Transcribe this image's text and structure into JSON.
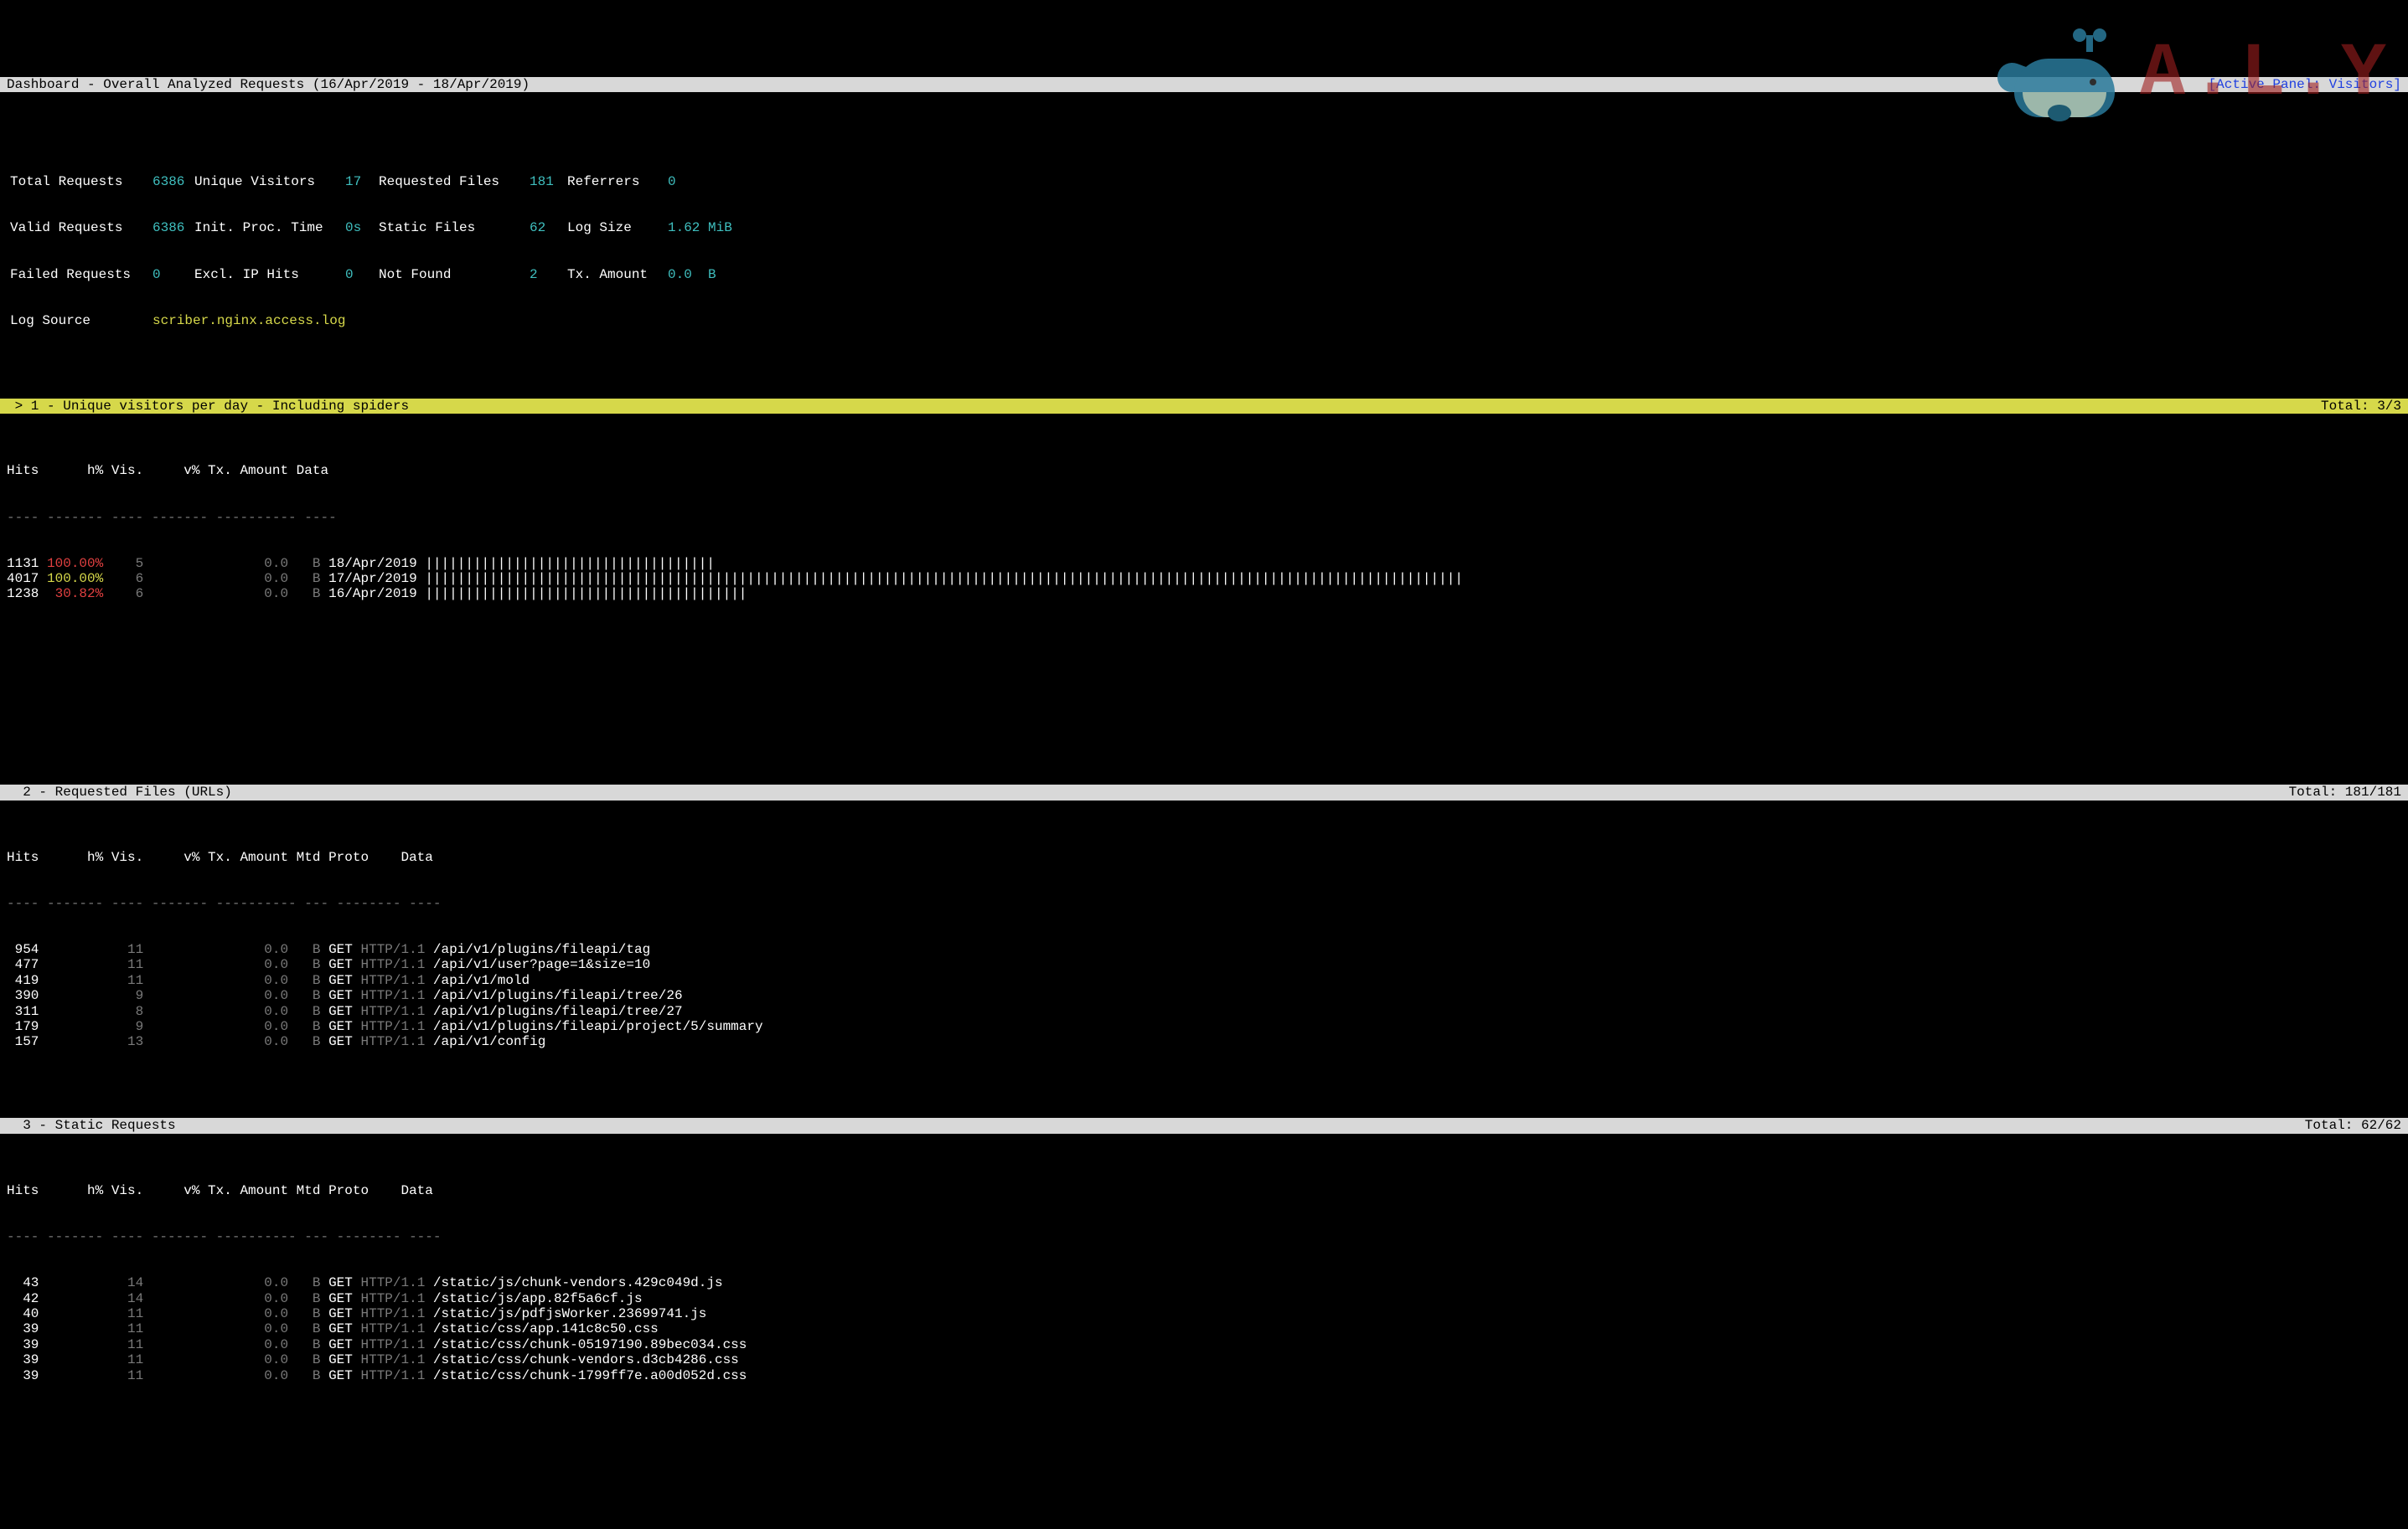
{
  "header": {
    "title": "Dashboard - Overall Analyzed Requests (16/Apr/2019 - 18/Apr/2019)",
    "right": "[Active Panel: Visitors]"
  },
  "summary": {
    "r1": {
      "l1": "Total Requests",
      "v1": "6386",
      "l2": "Unique Visitors",
      "v2": "17",
      "l3": "Requested Files",
      "v3": "181",
      "l4": "Referrers",
      "v4": "0"
    },
    "r2": {
      "l1": "Valid Requests",
      "v1": "6386",
      "l2": "Init. Proc. Time",
      "v2": "0s",
      "l3": "Static Files",
      "v3": "62",
      "l4": "Log Size",
      "v4": "1.62 MiB"
    },
    "r3": {
      "l1": "Failed Requests",
      "v1": "0",
      "l2": "Excl. IP Hits",
      "v2": "0",
      "l3": "Not Found",
      "v3": "2",
      "l4": "Tx. Amount",
      "v4": "0.0  B"
    },
    "r4": {
      "l1": "Log Source",
      "v1": "scriber.nginx.access.log"
    }
  },
  "panels": {
    "p1": {
      "title": " > 1 - Unique visitors per day - Including spiders",
      "total": "Total: 3/3"
    },
    "p2": {
      "title": "  2 - Requested Files (URLs)",
      "total": "Total: 181/181"
    },
    "p3": {
      "title": "  3 - Static Requests",
      "total": "Total: 62/62"
    }
  },
  "visitors": {
    "head": "Hits      h% Vis.     v% Tx. Amount Data",
    "div": "---- ------- ---- ------- ---------- ----",
    "rows": [
      {
        "hits": "1131",
        "hp": "100.00%",
        "hpclass": "c-red",
        "vis": "5",
        "tx": "0.0",
        "unit": "B",
        "date": "18/Apr/2019",
        "bar": "||||||||||||||||||||||||||||||||||||"
      },
      {
        "hits": "4017",
        "hp": "100.00%",
        "hpclass": "c-yel",
        "vis": "6",
        "tx": "0.0",
        "unit": "B",
        "date": "17/Apr/2019",
        "bar": "|||||||||||||||||||||||||||||||||||||||||||||||||||||||||||||||||||||||||||||||||||||||||||||||||||||||||||||||||||||||||||||||||"
      },
      {
        "hits": "1238",
        "hp": " 30.82%",
        "hpclass": "c-red",
        "vis": "6",
        "tx": "0.0",
        "unit": "B",
        "date": "16/Apr/2019",
        "bar": "||||||||||||||||||||||||||||||||||||||||"
      }
    ]
  },
  "requests": {
    "head": "Hits      h% Vis.     v% Tx. Amount Mtd Proto    Data",
    "div": "---- ------- ---- ------- ---------- --- -------- ----",
    "rows": [
      {
        "hits": " 954",
        "vis": "11",
        "tx": "0.0",
        "unit": "B",
        "mtd": "GET",
        "proto": "HTTP/1.1",
        "data": "/api/v1/plugins/fileapi/tag"
      },
      {
        "hits": " 477",
        "vis": "11",
        "tx": "0.0",
        "unit": "B",
        "mtd": "GET",
        "proto": "HTTP/1.1",
        "data": "/api/v1/user?page=1&size=10"
      },
      {
        "hits": " 419",
        "vis": "11",
        "tx": "0.0",
        "unit": "B",
        "mtd": "GET",
        "proto": "HTTP/1.1",
        "data": "/api/v1/mold"
      },
      {
        "hits": " 390",
        "vis": " 9",
        "tx": "0.0",
        "unit": "B",
        "mtd": "GET",
        "proto": "HTTP/1.1",
        "data": "/api/v1/plugins/fileapi/tree/26"
      },
      {
        "hits": " 311",
        "vis": " 8",
        "tx": "0.0",
        "unit": "B",
        "mtd": "GET",
        "proto": "HTTP/1.1",
        "data": "/api/v1/plugins/fileapi/tree/27"
      },
      {
        "hits": " 179",
        "vis": " 9",
        "tx": "0.0",
        "unit": "B",
        "mtd": "GET",
        "proto": "HTTP/1.1",
        "data": "/api/v1/plugins/fileapi/project/5/summary"
      },
      {
        "hits": " 157",
        "vis": "13",
        "tx": "0.0",
        "unit": "B",
        "mtd": "GET",
        "proto": "HTTP/1.1",
        "data": "/api/v1/config"
      }
    ]
  },
  "static": {
    "head": "Hits      h% Vis.     v% Tx. Amount Mtd Proto    Data",
    "div": "---- ------- ---- ------- ---------- --- -------- ----",
    "rows": [
      {
        "hits": "  43",
        "vis": "14",
        "tx": "0.0",
        "unit": "B",
        "mtd": "GET",
        "proto": "HTTP/1.1",
        "data": "/static/js/chunk-vendors.429c049d.js"
      },
      {
        "hits": "  42",
        "vis": "14",
        "tx": "0.0",
        "unit": "B",
        "mtd": "GET",
        "proto": "HTTP/1.1",
        "data": "/static/js/app.82f5a6cf.js"
      },
      {
        "hits": "  40",
        "vis": "11",
        "tx": "0.0",
        "unit": "B",
        "mtd": "GET",
        "proto": "HTTP/1.1",
        "data": "/static/js/pdfjsWorker.23699741.js"
      },
      {
        "hits": "  39",
        "vis": "11",
        "tx": "0.0",
        "unit": "B",
        "mtd": "GET",
        "proto": "HTTP/1.1",
        "data": "/static/css/app.141c8c50.css"
      },
      {
        "hits": "  39",
        "vis": "11",
        "tx": "0.0",
        "unit": "B",
        "mtd": "GET",
        "proto": "HTTP/1.1",
        "data": "/static/css/chunk-05197190.89bec034.css"
      },
      {
        "hits": "  39",
        "vis": "11",
        "tx": "0.0",
        "unit": "B",
        "mtd": "GET",
        "proto": "HTTP/1.1",
        "data": "/static/css/chunk-vendors.d3cb4286.css"
      },
      {
        "hits": "  39",
        "vis": "11",
        "tx": "0.0",
        "unit": "B",
        "mtd": "GET",
        "proto": "HTTP/1.1",
        "data": "/static/css/chunk-1799ff7e.a00d052d.css"
      }
    ]
  },
  "watermark": {
    "text": "A.L.Y"
  }
}
